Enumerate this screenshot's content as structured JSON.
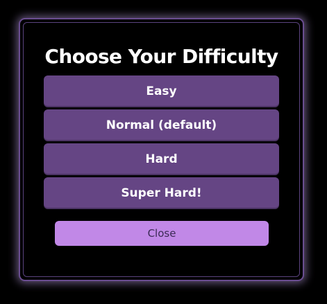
{
  "dialog": {
    "title": "Choose Your Difficulty",
    "options": [
      {
        "label": "Easy"
      },
      {
        "label": "Normal (default)"
      },
      {
        "label": "Hard"
      },
      {
        "label": "Super Hard!"
      }
    ],
    "close_label": "Close"
  },
  "colors": {
    "background": "#000000",
    "dialog_border": "#6a4d91",
    "option_fill": "#654584",
    "close_fill": "#c188e7",
    "text": "#ffffff"
  }
}
